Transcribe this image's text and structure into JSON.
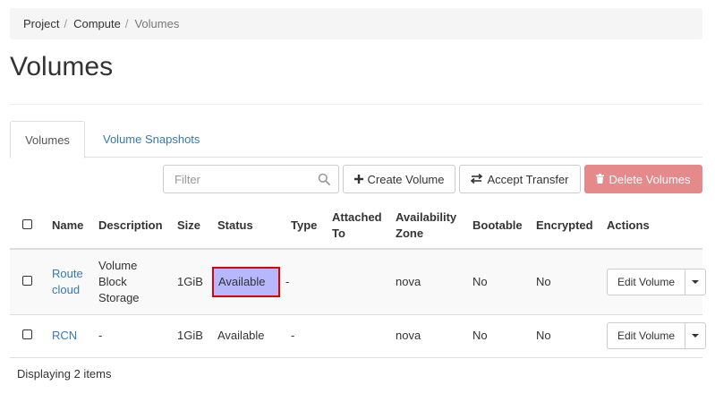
{
  "breadcrumb": {
    "items": [
      "Project",
      "Compute",
      "Volumes"
    ],
    "separator": "/"
  },
  "page": {
    "title": "Volumes"
  },
  "tabs": [
    {
      "label": "Volumes",
      "active": true
    },
    {
      "label": "Volume Snapshots",
      "active": false
    }
  ],
  "toolbar": {
    "filter_placeholder": "Filter",
    "create_label": "Create Volume",
    "accept_label": "Accept Transfer",
    "delete_label": "Delete Volumes"
  },
  "table": {
    "headers": {
      "name": "Name",
      "description": "Description",
      "size": "Size",
      "status": "Status",
      "type": "Type",
      "attached_line1": "Attached",
      "attached_line2": "To",
      "zone_line1": "Availability",
      "zone_line2": "Zone",
      "bootable": "Bootable",
      "encrypted": "Encrypted",
      "actions": "Actions"
    },
    "rows": [
      {
        "name_line1": "Route",
        "name_line2": "cloud",
        "desc_line1": "Volume",
        "desc_line2": "Block",
        "desc_line3": "Storage",
        "size": "1GiB",
        "status": "Available",
        "type": "-",
        "attached": "",
        "zone": "nova",
        "bootable": "No",
        "encrypted": "No",
        "action": "Edit Volume"
      },
      {
        "name": "RCN",
        "description": "-",
        "size": "1GiB",
        "status": "Available",
        "type": "-",
        "attached": "",
        "zone": "nova",
        "bootable": "No",
        "encrypted": "No",
        "action": "Edit Volume"
      }
    ]
  },
  "footer": {
    "text": "Displaying 2 items"
  },
  "colors": {
    "link": "#337ab7",
    "danger_button": "#e6898a",
    "status_highlight": "#b7b7fd",
    "highlight_border": "#e00000"
  }
}
